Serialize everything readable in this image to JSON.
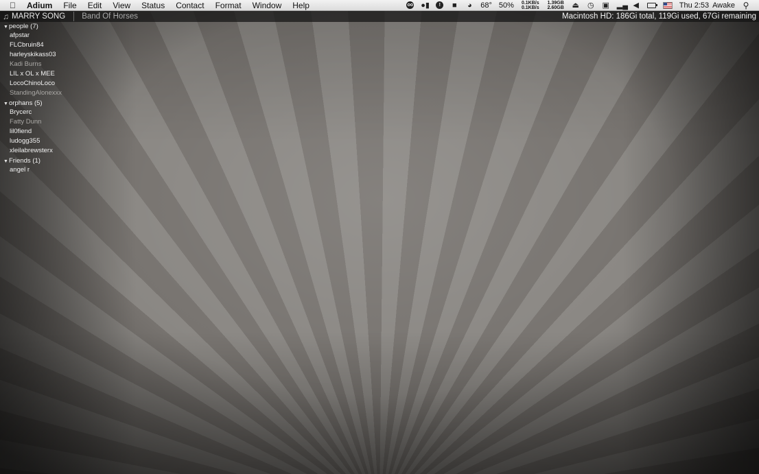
{
  "menubar": {
    "app_name": "Adium",
    "menus": [
      "File",
      "Edit",
      "View",
      "Status",
      "Contact",
      "Format",
      "Window",
      "Help"
    ],
    "status_items": {
      "temperature": "68°",
      "cpu_percent": "50%",
      "net_up": "0.1KB/s",
      "net_down": "0.1KB/s",
      "mem_top": "1.39GB",
      "mem_bottom": "2.60GB",
      "clock": "Thu 2:53",
      "caffeine_status": "Awake"
    }
  },
  "now_playing": {
    "song": "MARRY SONG",
    "artist": "Band Of Horses"
  },
  "disk_info": "Macintosh HD: 186Gi total, 119Gi used, 67Gi remaining",
  "contact_list": {
    "groups": [
      {
        "label": "people (7)",
        "contacts": [
          {
            "name": "afpstar",
            "offline": false
          },
          {
            "name": "FLCbruin84",
            "offline": false
          },
          {
            "name": "harleyskikass03",
            "offline": false
          },
          {
            "name": "Kadi Burns",
            "offline": true
          },
          {
            "name": "LIL x OL x MEE",
            "offline": false
          },
          {
            "name": "LocoChinoLoco",
            "offline": false
          },
          {
            "name": "StandingAlonexxx",
            "offline": true
          }
        ]
      },
      {
        "label": "orphans (5)",
        "contacts": [
          {
            "name": "Brycerc",
            "offline": false
          },
          {
            "name": "Fatty Dunn",
            "offline": true
          },
          {
            "name": "lil0fiend",
            "offline": false
          },
          {
            "name": "ludogg355",
            "offline": false
          },
          {
            "name": "xleilabrewsterx",
            "offline": false
          }
        ]
      },
      {
        "label": "Friends (1)",
        "contacts": [
          {
            "name": "angel r",
            "offline": false
          }
        ]
      }
    ]
  },
  "colors": {
    "menubar_bg": "#e6e6e6",
    "strip_bg": "#1e1e1e",
    "online_text": "#f2f2f2",
    "offline_text": "#aaa8a5"
  }
}
